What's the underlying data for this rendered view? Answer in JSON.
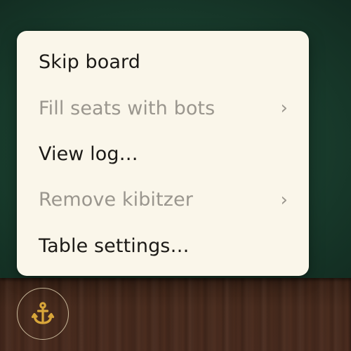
{
  "menu": {
    "items": [
      {
        "label": "Skip board",
        "enabled": true,
        "has_submenu": false
      },
      {
        "label": "Fill seats with bots",
        "enabled": false,
        "has_submenu": true,
        "chevron": "›"
      },
      {
        "label": "View log…",
        "enabled": true,
        "has_submenu": false
      },
      {
        "label": "Remove kibitzer",
        "enabled": false,
        "has_submenu": true,
        "chevron": "›"
      },
      {
        "label": "Table settings…",
        "enabled": true,
        "has_submenu": false
      }
    ]
  },
  "toolbar": {
    "menu_button_icon": "anchor-icon"
  },
  "colors": {
    "felt": "#183a2b",
    "wood": "#4a2c1e",
    "menu_background": "#faf6ea",
    "text_enabled": "#1c1a17",
    "text_disabled": "#9a968e",
    "anchor": "#d9a63a",
    "button_ring": "#c8b89a"
  }
}
